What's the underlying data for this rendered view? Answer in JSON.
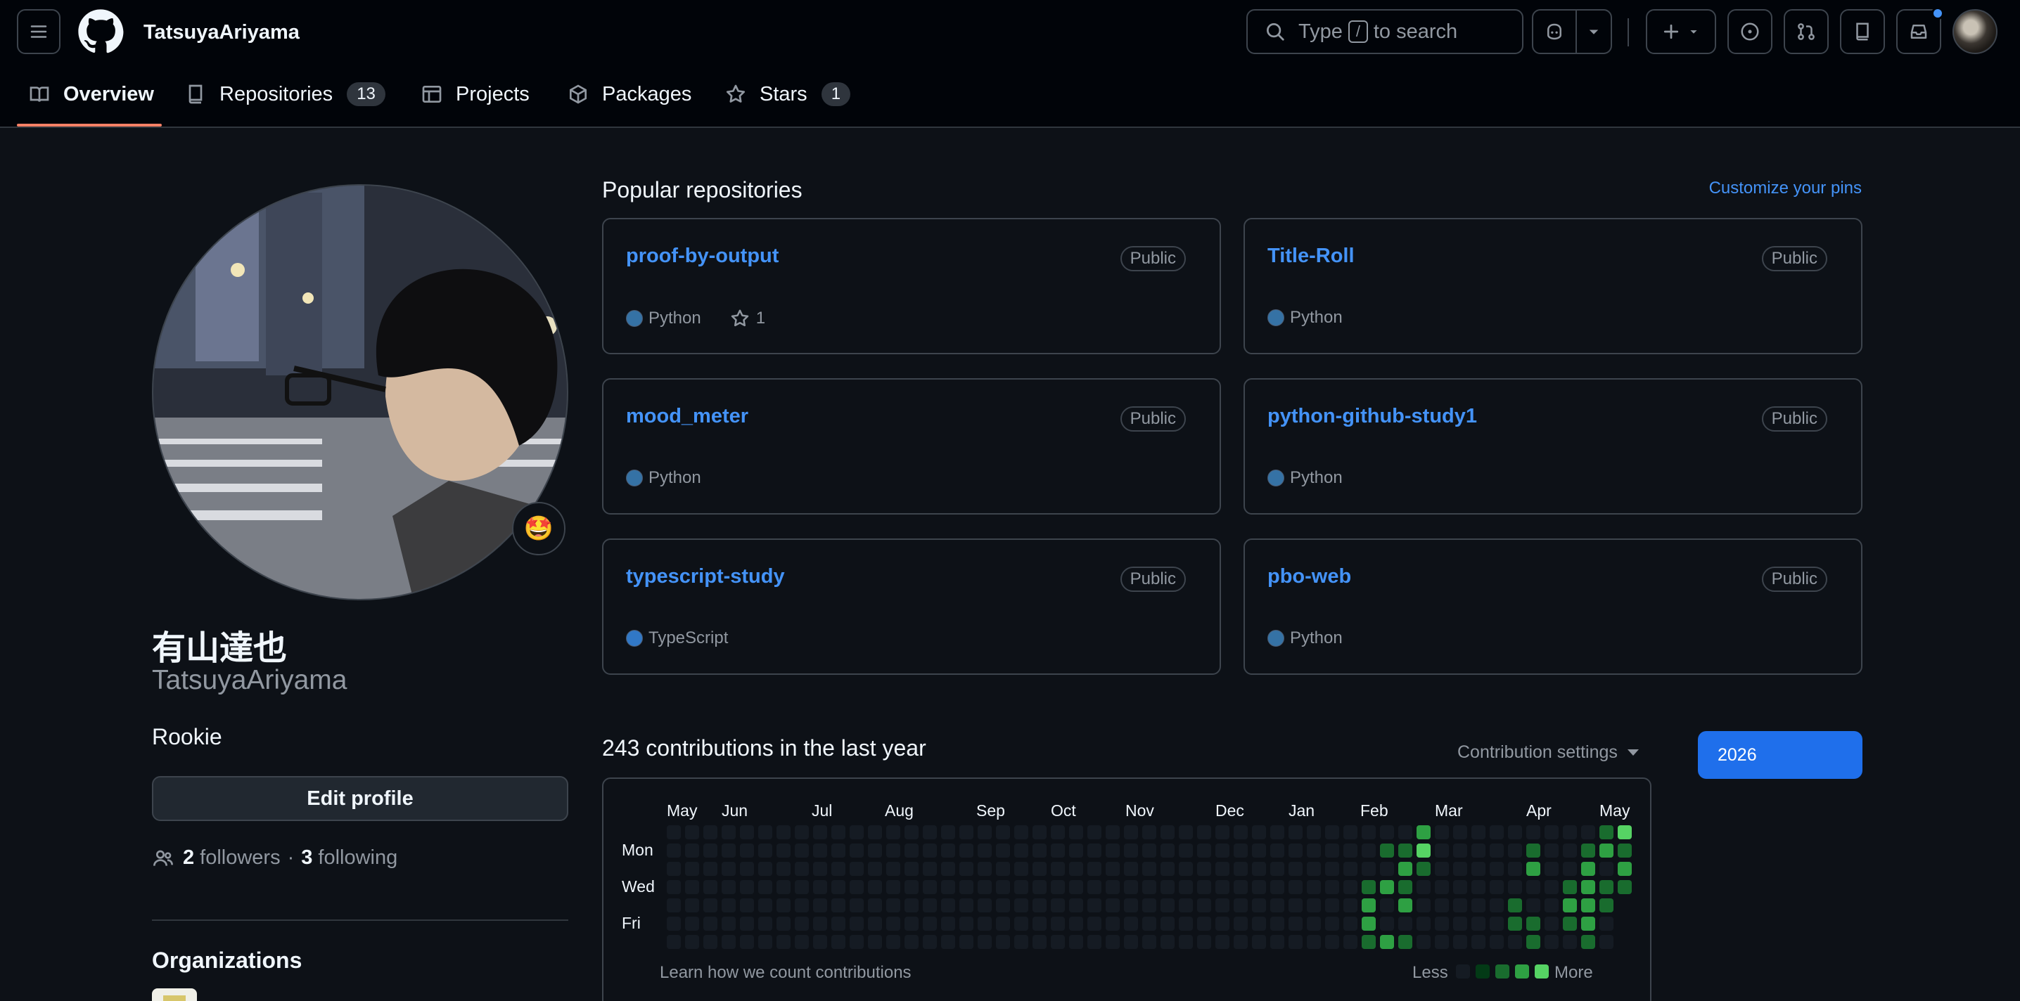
{
  "header": {
    "username": "TatsuyaAriyama",
    "search": {
      "before": "Type",
      "key": "/",
      "after": "to search"
    }
  },
  "tabs": [
    {
      "label": "Overview",
      "count": null,
      "icon": "book-icon",
      "active": true
    },
    {
      "label": "Repositories",
      "count": "13",
      "icon": "repo-icon"
    },
    {
      "label": "Projects",
      "count": null,
      "icon": "table-icon"
    },
    {
      "label": "Packages",
      "count": null,
      "icon": "package-icon"
    },
    {
      "label": "Stars",
      "count": "1",
      "icon": "star-icon"
    }
  ],
  "profile": {
    "name": "有山達也",
    "login": "TatsuyaAriyama",
    "bio": "Rookie",
    "status_emoji": "🤩",
    "edit_label": "Edit profile",
    "followers_count": "2",
    "followers_label": "followers",
    "separator": "·",
    "following_count": "3",
    "following_label": "following",
    "organizations_title": "Organizations"
  },
  "pinned": {
    "title": "Popular repositories",
    "customize_label": "Customize your pins",
    "repos": [
      {
        "name": "proof-by-output",
        "visibility": "Public",
        "language": "Python",
        "lang_color": "#3572A5",
        "stars": "1"
      },
      {
        "name": "Title-Roll",
        "visibility": "Public",
        "language": "Python",
        "lang_color": "#3572A5"
      },
      {
        "name": "mood_meter",
        "visibility": "Public",
        "language": "Python",
        "lang_color": "#3572A5"
      },
      {
        "name": "python-github-study1",
        "visibility": "Public",
        "language": "Python",
        "lang_color": "#3572A5"
      },
      {
        "name": "typescript-study",
        "visibility": "Public",
        "language": "TypeScript",
        "lang_color": "#3178C6"
      },
      {
        "name": "pbo-web",
        "visibility": "Public",
        "language": "Python",
        "lang_color": "#3572A5"
      }
    ]
  },
  "contributions": {
    "title": "243 contributions in the last year",
    "settings_label": "Contribution settings",
    "year": "2026",
    "months": [
      "May",
      "Jun",
      "Jul",
      "Aug",
      "Sep",
      "Oct",
      "Nov",
      "Dec",
      "Jan",
      "Feb",
      "Mar",
      "Apr",
      "May"
    ],
    "days": [
      "Mon",
      "Wed",
      "Fri"
    ],
    "learn_label": "Learn how we count contributions",
    "less_label": "Less",
    "more_label": "More",
    "level_colors": [
      "#151b23",
      "#033a16",
      "#196c2e",
      "#2ea043",
      "#56d364"
    ],
    "active_cells": [
      [
        38,
        3,
        2
      ],
      [
        38,
        4,
        3
      ],
      [
        38,
        5,
        3
      ],
      [
        38,
        6,
        2
      ],
      [
        39,
        1,
        2
      ],
      [
        39,
        3,
        3
      ],
      [
        39,
        6,
        3
      ],
      [
        39,
        7,
        2
      ],
      [
        40,
        1,
        2
      ],
      [
        40,
        2,
        3
      ],
      [
        40,
        3,
        2
      ],
      [
        40,
        4,
        3
      ],
      [
        40,
        6,
        2
      ],
      [
        40,
        7,
        4
      ],
      [
        41,
        0,
        3
      ],
      [
        41,
        1,
        4
      ],
      [
        41,
        2,
        2
      ],
      [
        46,
        4,
        2
      ],
      [
        46,
        5,
        2
      ],
      [
        47,
        1,
        2
      ],
      [
        47,
        2,
        3
      ],
      [
        47,
        5,
        2
      ],
      [
        47,
        6,
        2
      ],
      [
        49,
        3,
        2
      ],
      [
        49,
        4,
        3
      ],
      [
        49,
        5,
        2
      ],
      [
        50,
        1,
        2
      ],
      [
        50,
        2,
        3
      ],
      [
        50,
        3,
        3
      ],
      [
        50,
        4,
        3
      ],
      [
        50,
        5,
        3
      ],
      [
        50,
        6,
        2
      ],
      [
        50,
        7,
        2
      ],
      [
        51,
        0,
        2
      ],
      [
        51,
        1,
        3
      ],
      [
        51,
        3,
        2
      ],
      [
        51,
        4,
        2
      ],
      [
        52,
        0,
        4
      ],
      [
        52,
        1,
        2
      ],
      [
        52,
        2,
        3
      ],
      [
        52,
        3,
        2
      ],
      [
        35,
        7,
        2
      ],
      [
        36,
        7,
        2
      ]
    ]
  }
}
